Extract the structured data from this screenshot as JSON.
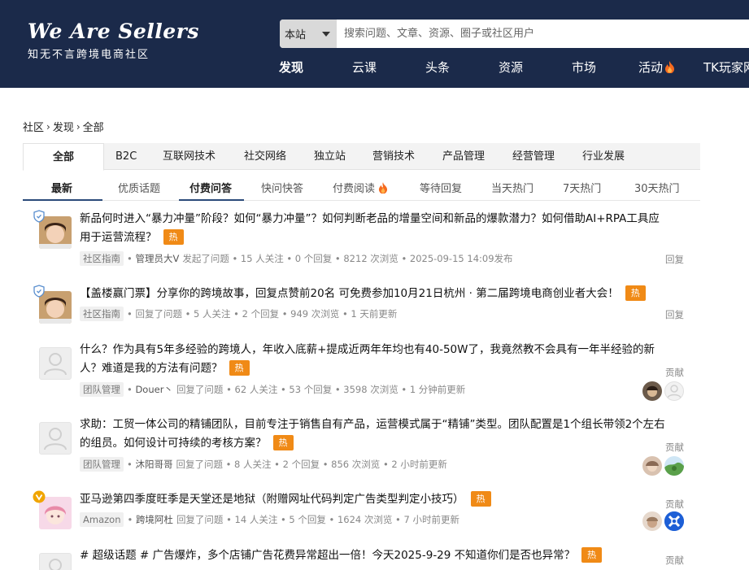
{
  "logo": {
    "main": "We Are Sellers",
    "sub": "知无不言跨境电商社区"
  },
  "search": {
    "scope": "本站",
    "placeholder": "搜索问题、文章、资源、圈子或社区用户"
  },
  "main_nav": [
    "发现",
    "云课",
    "头条",
    "资源",
    "市场",
    "活动",
    "TK玩家网"
  ],
  "breadcrumb": [
    "社区",
    "发现",
    "全部"
  ],
  "category_tabs": [
    "全部",
    "B2C",
    "互联网技术",
    "社交网络",
    "独立站",
    "营销技术",
    "产品管理",
    "经营管理",
    "行业发展"
  ],
  "sub_tabs": [
    "最新",
    "优质话题",
    "付费问答",
    "快问快答",
    "付费阅读",
    "等待回复",
    "当天热门",
    "7天热门",
    "30天热门"
  ],
  "hot_label": "热",
  "colors": {
    "header": "#1b2a4a",
    "hot": "#f08a16",
    "accent": "#2a4a7a"
  },
  "feed": [
    {
      "title": "新品何时进入“暴力冲量”阶段？如何“暴力冲量”？如何判断老品的增量空间和新品的爆款潜力？如何借助AI+RPA工具应用于运营流程？",
      "tag": "社区指南",
      "user": "管理员大V",
      "meta": "发起了问题 • 15 人关注 • 0 个回复 • 8212 次浏览 • 2025-09-15 14:09发布",
      "right": "回复",
      "avatar": "photo-girl",
      "badge": "shield-icon"
    },
    {
      "title": "【盖楼赢门票】分享你的跨境故事，回复点赞前20名 可免费参加10月21日杭州 · 第二届跨境电商创业者大会！",
      "tag": "社区指南",
      "user": "",
      "meta": "回复了问题 • 5 人关注 • 2 个回复 • 949 次浏览 • 1 天前更新",
      "right": "回复",
      "avatar": "photo-girl",
      "badge": "shield-icon"
    },
    {
      "title": "什么？作为具有5年多经验的跨境人，年收入底薪+提成近两年年均也有40-50W了，我竟然教不会具有一年半经验的新人？难道是我的方法有问题？",
      "tag": "团队管理",
      "user": "Douer丶",
      "meta": "回复了问题 • 62 人关注 • 53 个回复 • 3598 次浏览 • 1 分钟前更新",
      "right": "贡献",
      "avatar": "default",
      "badge": ""
    },
    {
      "title": "求助：工贸一体公司的精铺团队，目前专注于销售自有产品，运营模式属于“精铺”类型。团队配置是1个组长带领2个左右的组员。如何设计可持续的考核方案？",
      "tag": "团队管理",
      "user": "沐阳哥哥",
      "meta": "回复了问题 • 8 人关注 • 2 个回复 • 856 次浏览 • 2 小时前更新",
      "right": "贡献",
      "avatar": "default",
      "badge": ""
    },
    {
      "title": "亚马逊第四季度旺季是天堂还是地狱（附赠网址代码判定广告类型判定小技巧）",
      "tag": "Amazon",
      "user": "跨境阿杜",
      "meta": "回复了问题 • 14 人关注 • 5 个回复 • 1624 次浏览 • 7 小时前更新",
      "right": "贡献",
      "avatar": "photo-cartoon",
      "badge": "v-icon"
    },
    {
      "title": "# 超级话题 # 广告爆炸，多个店铺广告花费异常超出一倍！今天2025-9-29 不知道你们是否也异常？",
      "tag": "",
      "user": "",
      "meta": "",
      "right": "贡献",
      "avatar": "default",
      "badge": ""
    }
  ]
}
